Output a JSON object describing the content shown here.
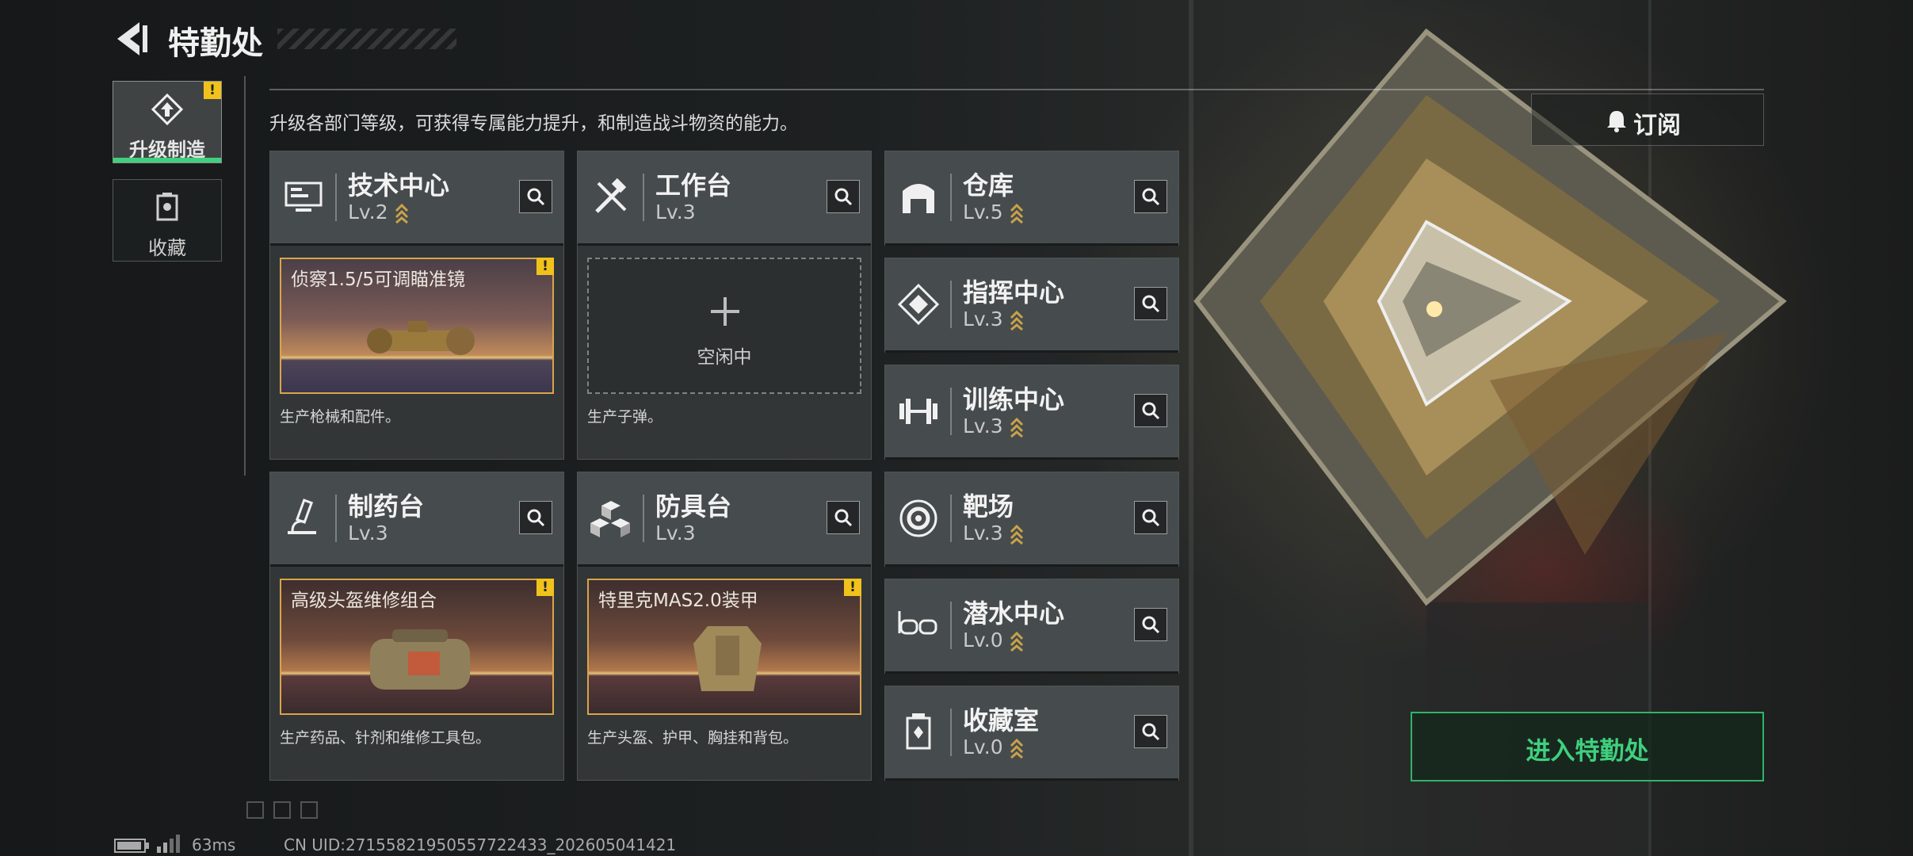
{
  "header": {
    "title": "特勤处"
  },
  "sidebar": {
    "tabs": [
      {
        "label": "升级制造",
        "active": true,
        "alert": "!"
      },
      {
        "label": "收藏",
        "active": false
      }
    ]
  },
  "description": "升级各部门等级，可获得专属能力提升，和制造战斗物资的能力。",
  "production_cards": [
    {
      "name": "技术中心",
      "level": "Lv.2",
      "item": "侦察1.5/5可调瞄准镜",
      "alert": "!",
      "desc": "生产枪械和配件。",
      "icon": "monitor-icon"
    },
    {
      "name": "工作台",
      "level": "Lv.3",
      "idle_label": "空闲中",
      "desc": "生产子弹。",
      "icon": "tools-icon"
    },
    {
      "name": "制药台",
      "level": "Lv.3",
      "item": "高级头盔维修组合",
      "alert": "!",
      "desc": "生产药品、针剂和维修工具包。",
      "icon": "microscope-icon"
    },
    {
      "name": "防具台",
      "level": "Lv.3",
      "item": "特里克MAS2.0装甲",
      "alert": "!",
      "desc": "生产头盔、护甲、胸挂和背包。",
      "icon": "cubes-icon"
    }
  ],
  "facilities": [
    {
      "name": "仓库",
      "level": "Lv.5",
      "icon": "warehouse-icon"
    },
    {
      "name": "指挥中心",
      "level": "Lv.3",
      "icon": "command-icon"
    },
    {
      "name": "训练中心",
      "level": "Lv.3",
      "icon": "dumbbell-icon"
    },
    {
      "name": "靶场",
      "level": "Lv.3",
      "icon": "target-icon"
    },
    {
      "name": "潜水中心",
      "level": "Lv.0",
      "icon": "diving-mask-icon"
    },
    {
      "name": "收藏室",
      "level": "Lv.0",
      "icon": "trophy-icon"
    }
  ],
  "subscribe_label": "订阅",
  "enter_label": "进入特勤处",
  "footer": {
    "ping": "63ms",
    "uid": "CN UID:27155821950557722433_202605041421"
  },
  "colors": {
    "accent": "#3fd07e",
    "warning": "#f1c21b",
    "item_frame": "#d9a44a"
  }
}
